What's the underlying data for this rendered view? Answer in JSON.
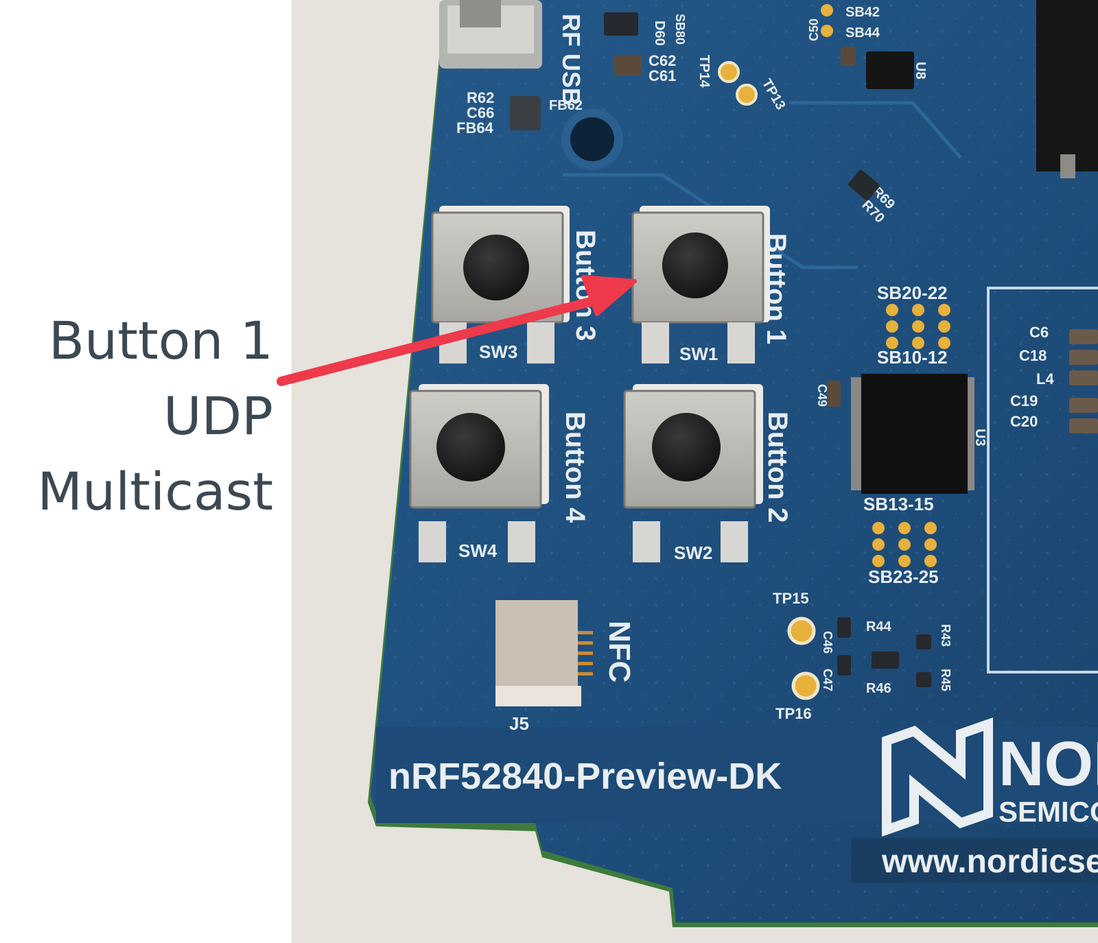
{
  "callout": {
    "line1": "Button 1",
    "line2": "UDP",
    "line3": "Multicast",
    "arrow_color": "#ee3a4a"
  },
  "board": {
    "model_label": "nRF52840-Preview-DK",
    "brand": "NORDIC",
    "brand_sub": "SEMICONDUCTOR",
    "url": "www.nordicsemi.com",
    "pcb_color": "#1f4f7c",
    "buttons": [
      {
        "switch_label": "SW1",
        "name": "Button 1"
      },
      {
        "switch_label": "SW2",
        "name": "Button 2"
      },
      {
        "switch_label": "SW3",
        "name": "Button 3"
      },
      {
        "switch_label": "SW4",
        "name": "Button 4"
      }
    ],
    "silkscreen": {
      "usb": "RF USB",
      "nfc": "NFC",
      "nfc_connector": "J5",
      "u3": "U3",
      "u8": "U8",
      "sb20_22": "SB20-22",
      "sb10_12": "SB10-12",
      "sb13_15": "SB13-15",
      "sb23_25": "SB23-25",
      "sb42": "SB42",
      "sb44": "SB44",
      "sb80": "SB80",
      "tp13": "TP13",
      "tp14": "TP14",
      "tp15": "TP15",
      "tp16": "TP16",
      "r62": "R62",
      "c66": "C66",
      "fb64": "FB64",
      "fb62": "FB62",
      "d60": "D60",
      "c62": "C62",
      "c61": "C61",
      "c50": "C50",
      "r69": "R69",
      "r70": "R70",
      "c6": "C6",
      "c18": "C18",
      "l4": "L4",
      "c19": "C19",
      "c20": "C20",
      "c49": "C49",
      "r44": "R44",
      "r43": "R43",
      "r45": "R45",
      "r46": "R46",
      "c46": "C46",
      "c47": "C47"
    }
  }
}
